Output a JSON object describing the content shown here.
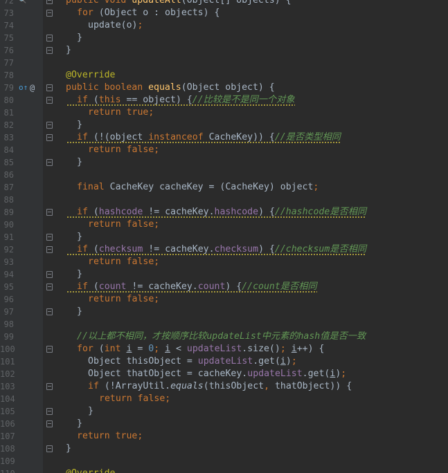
{
  "lines": [
    {
      "num": "72",
      "marker": "search",
      "fold": "open",
      "indent": 0,
      "tokens": [
        [
          "kw",
          "public "
        ],
        [
          "kw",
          "void "
        ],
        [
          "fn",
          "updateAll"
        ],
        [
          "text",
          "(Object[] objects) {"
        ]
      ]
    },
    {
      "num": "73",
      "fold": "open",
      "indent": 1,
      "tokens": [
        [
          "kw",
          "for "
        ],
        [
          "text",
          "(Object o : objects) {"
        ]
      ]
    },
    {
      "num": "74",
      "indent": 2,
      "tokens": [
        [
          "text",
          "update(o)"
        ],
        [
          "kw",
          ";"
        ]
      ]
    },
    {
      "num": "75",
      "fold": "close",
      "indent": 1,
      "tokens": [
        [
          "text",
          "}"
        ]
      ]
    },
    {
      "num": "76",
      "fold": "close",
      "indent": 0,
      "tokens": [
        [
          "text",
          "}"
        ]
      ]
    },
    {
      "num": "77",
      "indent": 0,
      "tokens": []
    },
    {
      "num": "78",
      "indent": 0,
      "tokens": [
        [
          "ann",
          "@Override"
        ]
      ]
    },
    {
      "num": "79",
      "marker": "override",
      "at": "@",
      "fold": "open",
      "indent": 0,
      "tokens": [
        [
          "kw",
          "public "
        ],
        [
          "kw",
          "boolean "
        ],
        [
          "fn",
          "equals"
        ],
        [
          "text",
          "(Object object) {"
        ]
      ]
    },
    {
      "num": "80",
      "fold": "open",
      "indent": 1,
      "warn": true,
      "tokens": [
        [
          "kw",
          "if "
        ],
        [
          "text",
          "("
        ],
        [
          "kw",
          "this "
        ],
        [
          "text",
          "== object) {"
        ],
        [
          "cmtcn",
          "//比较是不是同一个对象"
        ]
      ]
    },
    {
      "num": "81",
      "indent": 2,
      "tokens": [
        [
          "kw",
          "return "
        ],
        [
          "kw",
          "true;"
        ]
      ]
    },
    {
      "num": "82",
      "fold": "close",
      "indent": 1,
      "tokens": [
        [
          "text",
          "}"
        ]
      ]
    },
    {
      "num": "83",
      "fold": "open",
      "indent": 1,
      "warn": true,
      "tokens": [
        [
          "kw",
          "if "
        ],
        [
          "text",
          "(!(object "
        ],
        [
          "kw",
          "instanceof "
        ],
        [
          "text",
          "CacheKey)) {"
        ],
        [
          "cmtcn",
          "//是否类型相同"
        ]
      ]
    },
    {
      "num": "84",
      "indent": 2,
      "tokens": [
        [
          "kw",
          "return "
        ],
        [
          "kw",
          "false;"
        ]
      ]
    },
    {
      "num": "85",
      "fold": "close",
      "indent": 1,
      "tokens": [
        [
          "text",
          "}"
        ]
      ]
    },
    {
      "num": "86",
      "indent": 0,
      "tokens": []
    },
    {
      "num": "87",
      "indent": 1,
      "tokens": [
        [
          "kw",
          "final "
        ],
        [
          "text",
          "CacheKey cacheKey = (CacheKey) object"
        ],
        [
          "kw",
          ";"
        ]
      ]
    },
    {
      "num": "88",
      "indent": 0,
      "tokens": []
    },
    {
      "num": "89",
      "fold": "open",
      "indent": 1,
      "warn": true,
      "tokens": [
        [
          "kw",
          "if "
        ],
        [
          "text",
          "("
        ],
        [
          "field",
          "hashcode"
        ],
        [
          "text",
          " != cacheKey."
        ],
        [
          "field",
          "hashcode"
        ],
        [
          "text",
          ") {"
        ],
        [
          "cmtcn",
          "//hashcode是否相同"
        ]
      ]
    },
    {
      "num": "90",
      "indent": 2,
      "tokens": [
        [
          "kw",
          "return "
        ],
        [
          "kw",
          "false;"
        ]
      ]
    },
    {
      "num": "91",
      "fold": "close",
      "indent": 1,
      "tokens": [
        [
          "text",
          "}"
        ]
      ]
    },
    {
      "num": "92",
      "fold": "open",
      "indent": 1,
      "warn": true,
      "tokens": [
        [
          "kw",
          "if "
        ],
        [
          "text",
          "("
        ],
        [
          "field",
          "checksum"
        ],
        [
          "text",
          " != cacheKey."
        ],
        [
          "field",
          "checksum"
        ],
        [
          "text",
          ") {"
        ],
        [
          "cmtcn",
          "//checksum是否相同"
        ]
      ]
    },
    {
      "num": "93",
      "indent": 2,
      "tokens": [
        [
          "kw",
          "return "
        ],
        [
          "kw",
          "false;"
        ]
      ]
    },
    {
      "num": "94",
      "fold": "close",
      "indent": 1,
      "tokens": [
        [
          "text",
          "}"
        ]
      ]
    },
    {
      "num": "95",
      "fold": "open",
      "indent": 1,
      "warn": true,
      "tokens": [
        [
          "kw",
          "if "
        ],
        [
          "text",
          "("
        ],
        [
          "field",
          "count"
        ],
        [
          "text",
          " != cacheKey."
        ],
        [
          "field",
          "count"
        ],
        [
          "text",
          ") {"
        ],
        [
          "cmtcn",
          "//count是否相同"
        ]
      ]
    },
    {
      "num": "96",
      "indent": 2,
      "tokens": [
        [
          "kw",
          "return "
        ],
        [
          "kw",
          "false;"
        ]
      ]
    },
    {
      "num": "97",
      "fold": "close",
      "indent": 1,
      "tokens": [
        [
          "text",
          "}"
        ]
      ]
    },
    {
      "num": "98",
      "indent": 0,
      "tokens": []
    },
    {
      "num": "99",
      "indent": 1,
      "tokens": [
        [
          "cmtcn",
          "//以上都不相同，才按顺序比较updateList中元素的hash值是否一致"
        ]
      ]
    },
    {
      "num": "100",
      "fold": "open",
      "indent": 1,
      "tokens": [
        [
          "kw",
          "for "
        ],
        [
          "text",
          "("
        ],
        [
          "kw",
          "int "
        ],
        [
          "ul",
          "i"
        ],
        [
          "text",
          " = "
        ],
        [
          "num",
          "0"
        ],
        [
          "kw",
          "; "
        ],
        [
          "ul",
          "i"
        ],
        [
          "text",
          " < "
        ],
        [
          "field",
          "updateList"
        ],
        [
          "text",
          ".size()"
        ],
        [
          "kw",
          "; "
        ],
        [
          "ul",
          "i"
        ],
        [
          "text",
          "++) {"
        ]
      ]
    },
    {
      "num": "101",
      "indent": 2,
      "tokens": [
        [
          "text",
          "Object thisObject = "
        ],
        [
          "field",
          "updateList"
        ],
        [
          "text",
          ".get("
        ],
        [
          "ul",
          "i"
        ],
        [
          "text",
          ")"
        ],
        [
          "kw",
          ";"
        ]
      ]
    },
    {
      "num": "102",
      "indent": 2,
      "tokens": [
        [
          "text",
          "Object thatObject = cacheKey."
        ],
        [
          "field",
          "updateList"
        ],
        [
          "text",
          ".get("
        ],
        [
          "ul",
          "i"
        ],
        [
          "text",
          ")"
        ],
        [
          "kw",
          ";"
        ]
      ]
    },
    {
      "num": "103",
      "fold": "open",
      "indent": 2,
      "tokens": [
        [
          "kw",
          "if "
        ],
        [
          "text",
          "(!ArrayUtil."
        ],
        [
          "static",
          "equals"
        ],
        [
          "text",
          "(thisObject"
        ],
        [
          "kw",
          ", "
        ],
        [
          "text",
          "thatObject)) {"
        ]
      ]
    },
    {
      "num": "104",
      "indent": 3,
      "tokens": [
        [
          "kw",
          "return "
        ],
        [
          "kw",
          "false;"
        ]
      ]
    },
    {
      "num": "105",
      "fold": "close",
      "indent": 2,
      "tokens": [
        [
          "text",
          "}"
        ]
      ]
    },
    {
      "num": "106",
      "fold": "close",
      "indent": 1,
      "tokens": [
        [
          "text",
          "}"
        ]
      ]
    },
    {
      "num": "107",
      "indent": 1,
      "tokens": [
        [
          "kw",
          "return "
        ],
        [
          "kw",
          "true;"
        ]
      ]
    },
    {
      "num": "108",
      "fold": "close",
      "indent": 0,
      "tokens": [
        [
          "text",
          "}"
        ]
      ]
    },
    {
      "num": "109",
      "indent": 0,
      "tokens": []
    },
    {
      "num": "110",
      "indent": 0,
      "tokens": [
        [
          "ann",
          "@Override"
        ]
      ]
    }
  ],
  "colors": {
    "background": "#2b2b2b",
    "keyword": "#cc7832",
    "annotation": "#bbb529",
    "method": "#ffc66d",
    "field": "#9876aa",
    "comment": "#629755",
    "number": "#6897bb",
    "text": "#a9b7c6"
  }
}
